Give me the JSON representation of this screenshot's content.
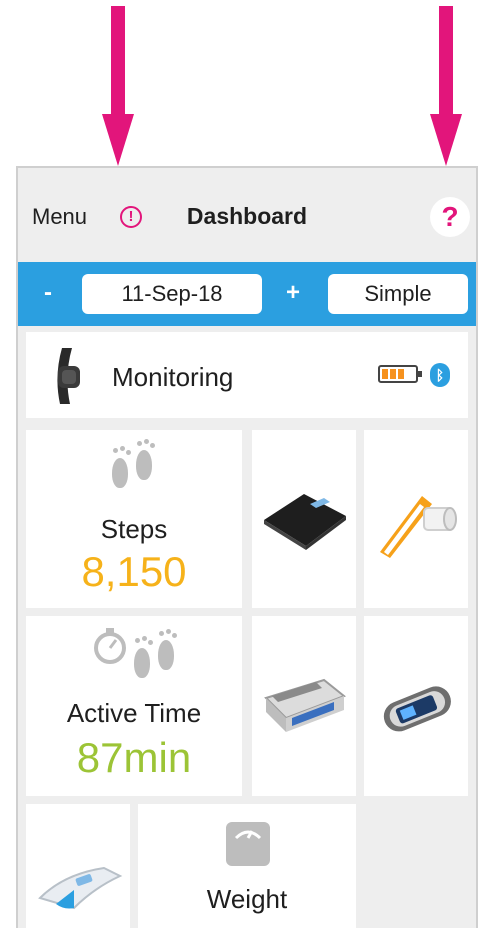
{
  "header": {
    "menu_label": "Menu",
    "info_glyph": "!",
    "title": "Dashboard",
    "help_glyph": "?"
  },
  "date_bar": {
    "decrement_label": "-",
    "date_value": "11-Sep-18",
    "increment_label": "+",
    "mode_value": "Simple"
  },
  "monitoring": {
    "label": "Monitoring",
    "battery_level_fraction": 0.75,
    "bluetooth_glyph": "ᛒ",
    "device_icon": "fitness-band-icon"
  },
  "tiles": {
    "steps": {
      "label": "Steps",
      "value": "8,150",
      "icon": "footprints-icon",
      "color": "#f6b21a"
    },
    "active_time": {
      "label": "Active Time",
      "value": "87min",
      "icon": "stopwatch-footprints-icon",
      "color": "#9cc436"
    },
    "weight": {
      "label": "Weight",
      "icon": "weight-scale-icon"
    },
    "devices": [
      "body-scale-icon",
      "spirometer-icon",
      "blood-pressure-monitor-icon",
      "pulse-oximeter-icon",
      "thermometer-icon"
    ]
  },
  "colors": {
    "accent_magenta": "#e2157b",
    "date_bar_blue": "#2b9fe0",
    "battery_orange": "#f6921e"
  }
}
